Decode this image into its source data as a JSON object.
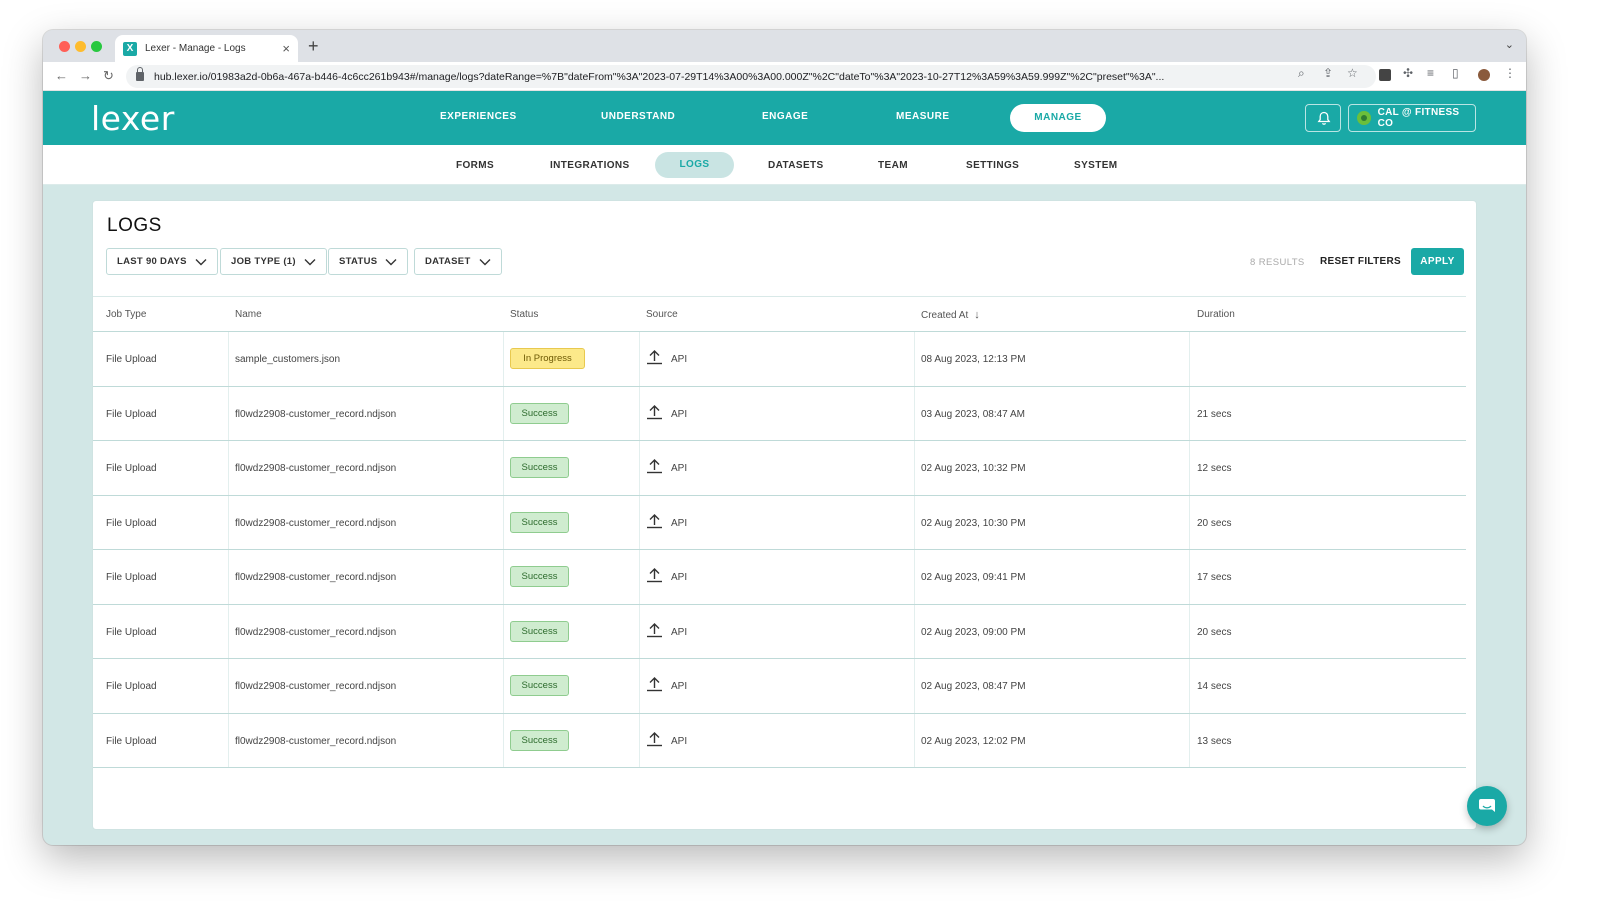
{
  "browser": {
    "tab_title": "Lexer - Manage - Logs",
    "tab_favicon": "X",
    "url": "hub.lexer.io/01983a2d-0b6a-467a-b446-4c6cc261b943#/manage/logs?dateRange=%7B\"dateFrom\"%3A\"2023-07-29T14%3A00%3A00.000Z\"%2C\"dateTo\"%3A\"2023-10-27T12%3A59%3A59.999Z\"%2C\"preset\"%3A\"..."
  },
  "header": {
    "logo": "lexer",
    "nav": [
      "EXPERIENCES",
      "UNDERSTAND",
      "ENGAGE",
      "MEASURE"
    ],
    "active_nav": "MANAGE",
    "account": "CAL @ FITNESS CO"
  },
  "subnav": {
    "items": [
      "FORMS",
      "INTEGRATIONS",
      "DATASETS",
      "TEAM",
      "SETTINGS",
      "SYSTEM"
    ],
    "active": "LOGS"
  },
  "page": {
    "title": "LOGS",
    "filters": [
      "LAST 90 DAYS",
      "JOB TYPE (1)",
      "STATUS",
      "DATASET"
    ],
    "results": "8 RESULTS",
    "reset_label": "RESET FILTERS",
    "apply_label": "APPLY"
  },
  "table": {
    "columns": [
      "Job Type",
      "Name",
      "Status",
      "Source",
      "Created At",
      "Duration"
    ],
    "rows": [
      {
        "job_type": "File Upload",
        "name": "sample_customers.json",
        "status": "In Progress",
        "source": "API",
        "created_at": "08 Aug 2023, 12:13 PM",
        "duration": ""
      },
      {
        "job_type": "File Upload",
        "name": "fl0wdz2908-customer_record.ndjson",
        "status": "Success",
        "source": "API",
        "created_at": "03 Aug 2023, 08:47 AM",
        "duration": "21 secs"
      },
      {
        "job_type": "File Upload",
        "name": "fl0wdz2908-customer_record.ndjson",
        "status": "Success",
        "source": "API",
        "created_at": "02 Aug 2023, 10:32 PM",
        "duration": "12 secs"
      },
      {
        "job_type": "File Upload",
        "name": "fl0wdz2908-customer_record.ndjson",
        "status": "Success",
        "source": "API",
        "created_at": "02 Aug 2023, 10:30 PM",
        "duration": "20 secs"
      },
      {
        "job_type": "File Upload",
        "name": "fl0wdz2908-customer_record.ndjson",
        "status": "Success",
        "source": "API",
        "created_at": "02 Aug 2023, 09:41 PM",
        "duration": "17 secs"
      },
      {
        "job_type": "File Upload",
        "name": "fl0wdz2908-customer_record.ndjson",
        "status": "Success",
        "source": "API",
        "created_at": "02 Aug 2023, 09:00 PM",
        "duration": "20 secs"
      },
      {
        "job_type": "File Upload",
        "name": "fl0wdz2908-customer_record.ndjson",
        "status": "Success",
        "source": "API",
        "created_at": "02 Aug 2023, 08:47 PM",
        "duration": "14 secs"
      },
      {
        "job_type": "File Upload",
        "name": "fl0wdz2908-customer_record.ndjson",
        "status": "Success",
        "source": "API",
        "created_at": "02 Aug 2023, 12:02 PM",
        "duration": "13 secs"
      }
    ]
  },
  "colors": {
    "brand": "#1aa9a6",
    "progress": "#fce98a",
    "success": "#cfeccf"
  }
}
